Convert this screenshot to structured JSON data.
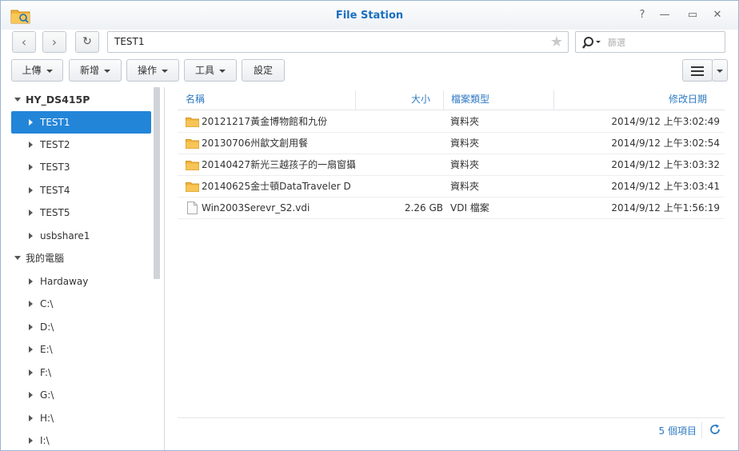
{
  "window": {
    "title": "File Station"
  },
  "window_controls": {
    "help": "?",
    "minimize": "—",
    "maximize": "▭",
    "close": "✕"
  },
  "nav": {
    "back": "‹",
    "forward": "›",
    "refresh": "↻"
  },
  "path": {
    "value": "TEST1"
  },
  "search": {
    "placeholder": "篩選"
  },
  "toolbar": {
    "upload": "上傳",
    "create": "新增",
    "action": "操作",
    "tools": "工具",
    "settings": "設定"
  },
  "sidebar": {
    "root1": "HY_DS415P",
    "root1_items": [
      "TEST1",
      "TEST2",
      "TEST3",
      "TEST4",
      "TEST5",
      "usbshare1"
    ],
    "root2": "我的電腦",
    "root2_items": [
      "Hardaway",
      "C:\\",
      "D:\\",
      "E:\\",
      "F:\\",
      "G:\\",
      "H:\\",
      "I:\\"
    ]
  },
  "table": {
    "columns": [
      "名稱",
      "大小",
      "檔案類型",
      "修改日期"
    ],
    "rows": [
      {
        "name": "20121217黃金博物館和九份",
        "size": "",
        "type": "資料夾",
        "modified": "2014/9/12 上午3:02:49",
        "icon": "folder-icon"
      },
      {
        "name": "20130706州歙文創用餐",
        "size": "",
        "type": "資料夾",
        "modified": "2014/9/12 上午3:02:54",
        "icon": "folder-icon"
      },
      {
        "name": "20140427新光三越孩子的一扇窗攝",
        "size": "",
        "type": "資料夾",
        "modified": "2014/9/12 上午3:03:32",
        "icon": "folder-icon"
      },
      {
        "name": "20140625金士頓DataTraveler D",
        "size": "",
        "type": "資料夾",
        "modified": "2014/9/12 上午3:03:41",
        "icon": "folder-icon"
      },
      {
        "name": "Win2003Serevr_S2.vdi",
        "size": "2.26 GB",
        "type": "VDI 檔案",
        "modified": "2014/9/12 上午1:56:19",
        "icon": "file-icon"
      }
    ]
  },
  "footer": {
    "count": "5 個項目"
  },
  "colors": {
    "accent": "#2385d8",
    "title": "#1a6fbf",
    "link": "#2f7ac4",
    "folder": "#f2b33d"
  }
}
